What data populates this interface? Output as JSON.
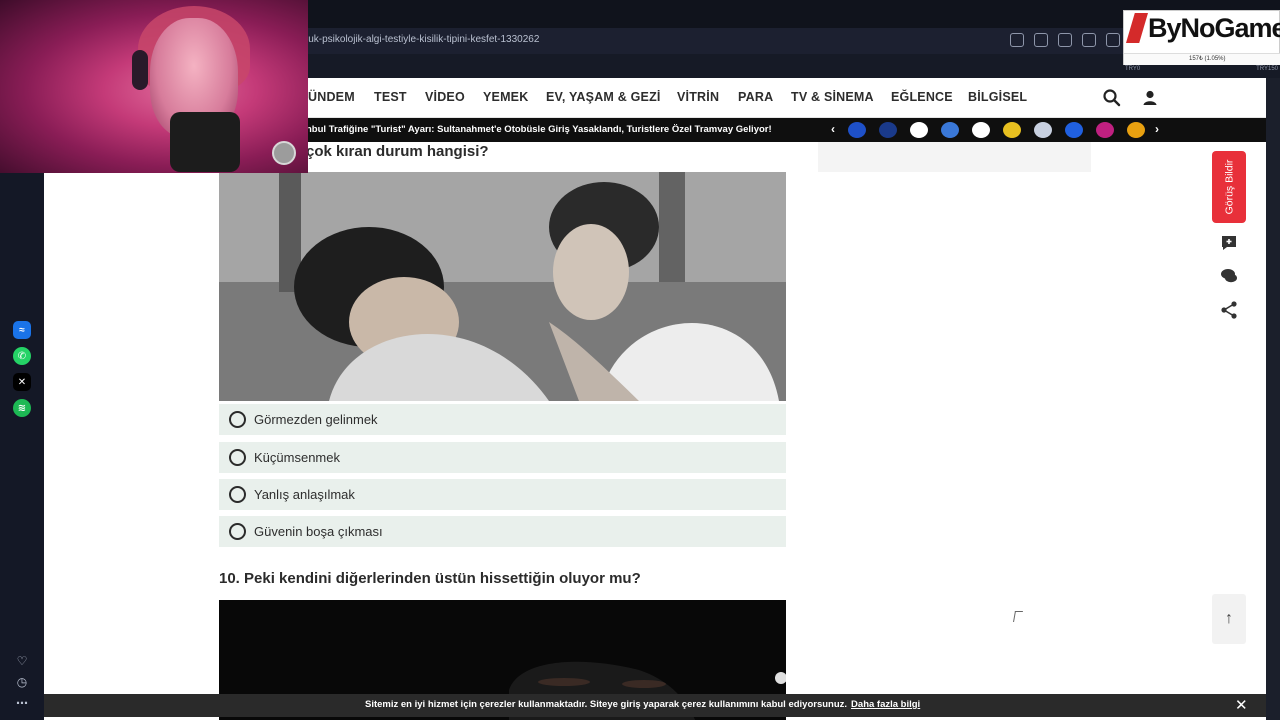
{
  "browser": {
    "url": "luk-psikolojik-algi-testiyle-kisilik-tipini-kesfet-1330262"
  },
  "nav": {
    "items": [
      "ÜNDEM",
      "TEST",
      "VİDEO",
      "YEMEK",
      "EV, YAŞAM & GEZİ",
      "VİTRİN",
      "PARA",
      "TV & SİNEMA",
      "EĞLENCE",
      "BİLGİSEL"
    ]
  },
  "ticker": {
    "headline": "nbul Trafiğine \"Turist\" Ayarı: Sultanahmet'e Otobüsle Giriş Yasaklandı, Turistlere Özel Tramvay Geliyor!",
    "prev": "‹",
    "next": "›"
  },
  "quiz": {
    "q9_partial": "çok kıran durum hangisi?",
    "options": [
      "Görmezden gelinmek",
      "Küçümsenmek",
      "Yanlış anlaşılmak",
      "Güvenin boşa çıkması"
    ],
    "q10": "10. Peki kendini diğerlerinden üstün hissettiğin oluyor mu?"
  },
  "side": {
    "feedback": "Görüş Bildir",
    "to_top": "↑"
  },
  "cookie": {
    "message": "Sitemiz en iyi hizmet için çerezler kullanmaktadır. Siteye giriş yaparak çerez kullanımını kabul ediyorsunuz.",
    "link": "Daha fazla bilgi",
    "close": "✕"
  },
  "overlay": {
    "brand": "ByNoGame",
    "progress_text": "157₺ (1.05%)",
    "left_value": "TRY0",
    "right_value": "TRY150"
  },
  "colors": {
    "accent": "#e8303a",
    "option_bg": "#e9f0ec",
    "ticker_bg": "#0f0f0f"
  }
}
